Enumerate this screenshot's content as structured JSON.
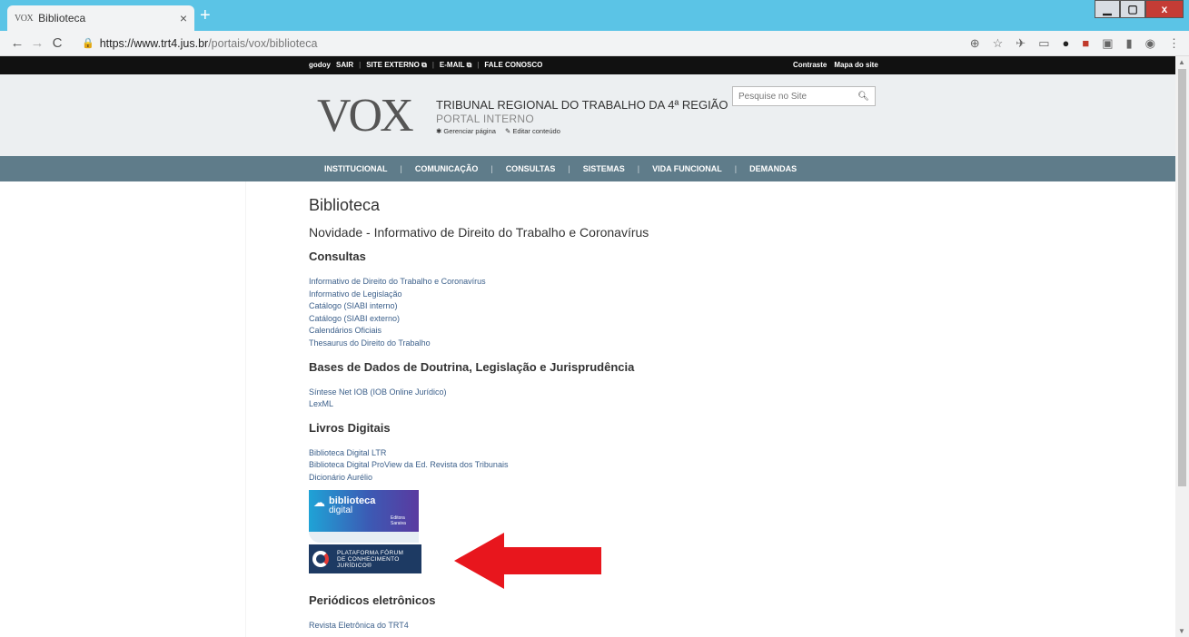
{
  "browser": {
    "tab_favicon": "VOX",
    "tab_title": "Biblioteca",
    "tab_close": "×",
    "new_tab": "+",
    "url_host": "https://www.trt4.jus.br",
    "url_path": "/portais/vox/biblioteca",
    "window": {
      "minimize": "▁",
      "restore": "▢",
      "close": "x"
    }
  },
  "topbar": {
    "user": "godoy",
    "logout": "SAIR",
    "external_site": "SITE EXTERNO",
    "email": "E-MAIL",
    "contact": "FALE CONOSCO",
    "contrast": "Contraste",
    "sitemap": "Mapa do site"
  },
  "header": {
    "logo": "VOX",
    "institution": "TRIBUNAL REGIONAL DO TRABALHO DA 4ª REGIÃO",
    "portal": "PORTAL INTERNO",
    "manage_page": "Gerenciar página",
    "edit_content": "Editar conteúdo",
    "search_placeholder": "Pesquise no Site"
  },
  "nav": {
    "items": [
      "INSTITUCIONAL",
      "COMUNICAÇÃO",
      "CONSULTAS",
      "SISTEMAS",
      "VIDA FUNCIONAL",
      "DEMANDAS"
    ]
  },
  "content": {
    "title": "Biblioteca",
    "news": "Novidade - Informativo de Direito do Trabalho e Coronavírus",
    "sections": [
      {
        "heading": "Consultas",
        "links": [
          "Informativo de Direito do Trabalho e Coronavírus",
          "Informativo de Legislação",
          "Catálogo (SIABI interno)",
          "Catálogo (SIABI externo)",
          "Calendários Oficiais",
          "Thesaurus do Direito do Trabalho"
        ]
      },
      {
        "heading": "Bases de Dados de Doutrina, Legislação e Jurisprudência",
        "links": [
          "Síntese Net IOB (IOB Online Jurídico)",
          "LexML"
        ]
      },
      {
        "heading": "Livros Digitais",
        "links": [
          "Biblioteca Digital LTR",
          "Biblioteca Digital ProView da Ed. Revista dos Tribunais",
          "Dicionário Aurélio"
        ]
      },
      {
        "heading": "Periódicos eletrônicos",
        "links": [
          "Revista Eletrônica do TRT4"
        ]
      }
    ],
    "banner_saraiva": {
      "line1": "biblioteca",
      "line2": "digital",
      "line3": "Editora Saraiva"
    },
    "banner_forum": {
      "line1": "PLATAFORMA FÓRUM",
      "line2": "DE CONHECIMENTO",
      "line3": "JURÍDICO®"
    }
  },
  "colors": {
    "nav_bg": "#5f7c8a",
    "link": "#3b5f8a",
    "arrow": "#e8161d",
    "header_bg": "#eceff1"
  }
}
